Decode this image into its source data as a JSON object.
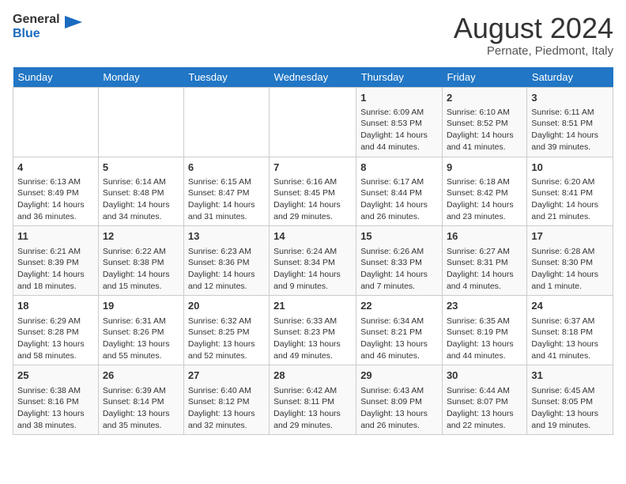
{
  "header": {
    "logo_general": "General",
    "logo_blue": "Blue",
    "month_year": "August 2024",
    "location": "Pernate, Piedmont, Italy"
  },
  "days_of_week": [
    "Sunday",
    "Monday",
    "Tuesday",
    "Wednesday",
    "Thursday",
    "Friday",
    "Saturday"
  ],
  "weeks": [
    [
      {
        "day": "",
        "content": ""
      },
      {
        "day": "",
        "content": ""
      },
      {
        "day": "",
        "content": ""
      },
      {
        "day": "",
        "content": ""
      },
      {
        "day": "1",
        "content": "Sunrise: 6:09 AM\nSunset: 8:53 PM\nDaylight: 14 hours and 44 minutes."
      },
      {
        "day": "2",
        "content": "Sunrise: 6:10 AM\nSunset: 8:52 PM\nDaylight: 14 hours and 41 minutes."
      },
      {
        "day": "3",
        "content": "Sunrise: 6:11 AM\nSunset: 8:51 PM\nDaylight: 14 hours and 39 minutes."
      }
    ],
    [
      {
        "day": "4",
        "content": "Sunrise: 6:13 AM\nSunset: 8:49 PM\nDaylight: 14 hours and 36 minutes."
      },
      {
        "day": "5",
        "content": "Sunrise: 6:14 AM\nSunset: 8:48 PM\nDaylight: 14 hours and 34 minutes."
      },
      {
        "day": "6",
        "content": "Sunrise: 6:15 AM\nSunset: 8:47 PM\nDaylight: 14 hours and 31 minutes."
      },
      {
        "day": "7",
        "content": "Sunrise: 6:16 AM\nSunset: 8:45 PM\nDaylight: 14 hours and 29 minutes."
      },
      {
        "day": "8",
        "content": "Sunrise: 6:17 AM\nSunset: 8:44 PM\nDaylight: 14 hours and 26 minutes."
      },
      {
        "day": "9",
        "content": "Sunrise: 6:18 AM\nSunset: 8:42 PM\nDaylight: 14 hours and 23 minutes."
      },
      {
        "day": "10",
        "content": "Sunrise: 6:20 AM\nSunset: 8:41 PM\nDaylight: 14 hours and 21 minutes."
      }
    ],
    [
      {
        "day": "11",
        "content": "Sunrise: 6:21 AM\nSunset: 8:39 PM\nDaylight: 14 hours and 18 minutes."
      },
      {
        "day": "12",
        "content": "Sunrise: 6:22 AM\nSunset: 8:38 PM\nDaylight: 14 hours and 15 minutes."
      },
      {
        "day": "13",
        "content": "Sunrise: 6:23 AM\nSunset: 8:36 PM\nDaylight: 14 hours and 12 minutes."
      },
      {
        "day": "14",
        "content": "Sunrise: 6:24 AM\nSunset: 8:34 PM\nDaylight: 14 hours and 9 minutes."
      },
      {
        "day": "15",
        "content": "Sunrise: 6:26 AM\nSunset: 8:33 PM\nDaylight: 14 hours and 7 minutes."
      },
      {
        "day": "16",
        "content": "Sunrise: 6:27 AM\nSunset: 8:31 PM\nDaylight: 14 hours and 4 minutes."
      },
      {
        "day": "17",
        "content": "Sunrise: 6:28 AM\nSunset: 8:30 PM\nDaylight: 14 hours and 1 minute."
      }
    ],
    [
      {
        "day": "18",
        "content": "Sunrise: 6:29 AM\nSunset: 8:28 PM\nDaylight: 13 hours and 58 minutes."
      },
      {
        "day": "19",
        "content": "Sunrise: 6:31 AM\nSunset: 8:26 PM\nDaylight: 13 hours and 55 minutes."
      },
      {
        "day": "20",
        "content": "Sunrise: 6:32 AM\nSunset: 8:25 PM\nDaylight: 13 hours and 52 minutes."
      },
      {
        "day": "21",
        "content": "Sunrise: 6:33 AM\nSunset: 8:23 PM\nDaylight: 13 hours and 49 minutes."
      },
      {
        "day": "22",
        "content": "Sunrise: 6:34 AM\nSunset: 8:21 PM\nDaylight: 13 hours and 46 minutes."
      },
      {
        "day": "23",
        "content": "Sunrise: 6:35 AM\nSunset: 8:19 PM\nDaylight: 13 hours and 44 minutes."
      },
      {
        "day": "24",
        "content": "Sunrise: 6:37 AM\nSunset: 8:18 PM\nDaylight: 13 hours and 41 minutes."
      }
    ],
    [
      {
        "day": "25",
        "content": "Sunrise: 6:38 AM\nSunset: 8:16 PM\nDaylight: 13 hours and 38 minutes."
      },
      {
        "day": "26",
        "content": "Sunrise: 6:39 AM\nSunset: 8:14 PM\nDaylight: 13 hours and 35 minutes."
      },
      {
        "day": "27",
        "content": "Sunrise: 6:40 AM\nSunset: 8:12 PM\nDaylight: 13 hours and 32 minutes."
      },
      {
        "day": "28",
        "content": "Sunrise: 6:42 AM\nSunset: 8:11 PM\nDaylight: 13 hours and 29 minutes."
      },
      {
        "day": "29",
        "content": "Sunrise: 6:43 AM\nSunset: 8:09 PM\nDaylight: 13 hours and 26 minutes."
      },
      {
        "day": "30",
        "content": "Sunrise: 6:44 AM\nSunset: 8:07 PM\nDaylight: 13 hours and 22 minutes."
      },
      {
        "day": "31",
        "content": "Sunrise: 6:45 AM\nSunset: 8:05 PM\nDaylight: 13 hours and 19 minutes."
      }
    ]
  ]
}
